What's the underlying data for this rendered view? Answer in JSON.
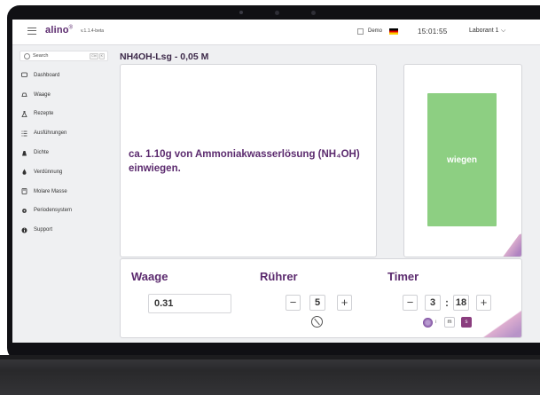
{
  "topbar": {
    "brand": "alino",
    "brand_mark": "®",
    "version": "v.1.1.4-beta",
    "demo_label": "Demo",
    "clock": "15:01:55",
    "user": "Laborant 1"
  },
  "sidebar": {
    "search_label": "Search",
    "search_keys": [
      "Ctrl",
      "K"
    ],
    "items": [
      {
        "label": "Dashboard",
        "icon": "dashboard-icon"
      },
      {
        "label": "Waage",
        "icon": "scale-icon"
      },
      {
        "label": "Rezepte",
        "icon": "flask-icon"
      },
      {
        "label": "Ausführungen",
        "icon": "list-icon"
      },
      {
        "label": "Dichte",
        "icon": "density-icon"
      },
      {
        "label": "Verdünnung",
        "icon": "drop-icon"
      },
      {
        "label": "Molare Masse",
        "icon": "calculator-icon"
      },
      {
        "label": "Periodensystem",
        "icon": "gear-icon"
      },
      {
        "label": "Support",
        "icon": "info-icon"
      }
    ]
  },
  "main": {
    "title": "NH4OH-Lsg - 0,05 M",
    "instruction": "ca. 1.10g von Ammoniakwasserlösung (NH₄OH) einwiegen.",
    "weigh_button": "wiegen"
  },
  "controls": {
    "scale_title": "Waage",
    "scale_value": "0.31",
    "stirrer_title": "Rührer",
    "stirrer_value": "5",
    "timer_title": "Timer",
    "timer_minutes": "3",
    "timer_seconds": "18",
    "timer_separator": ":",
    "minus": "−",
    "plus": "+",
    "unit_i": "i",
    "unit_m": "m",
    "unit_s": "s"
  },
  "colors": {
    "brand_purple": "#5b2a6e",
    "weigh_green": "#8dcf82",
    "active_unit": "#8a3d7e"
  }
}
